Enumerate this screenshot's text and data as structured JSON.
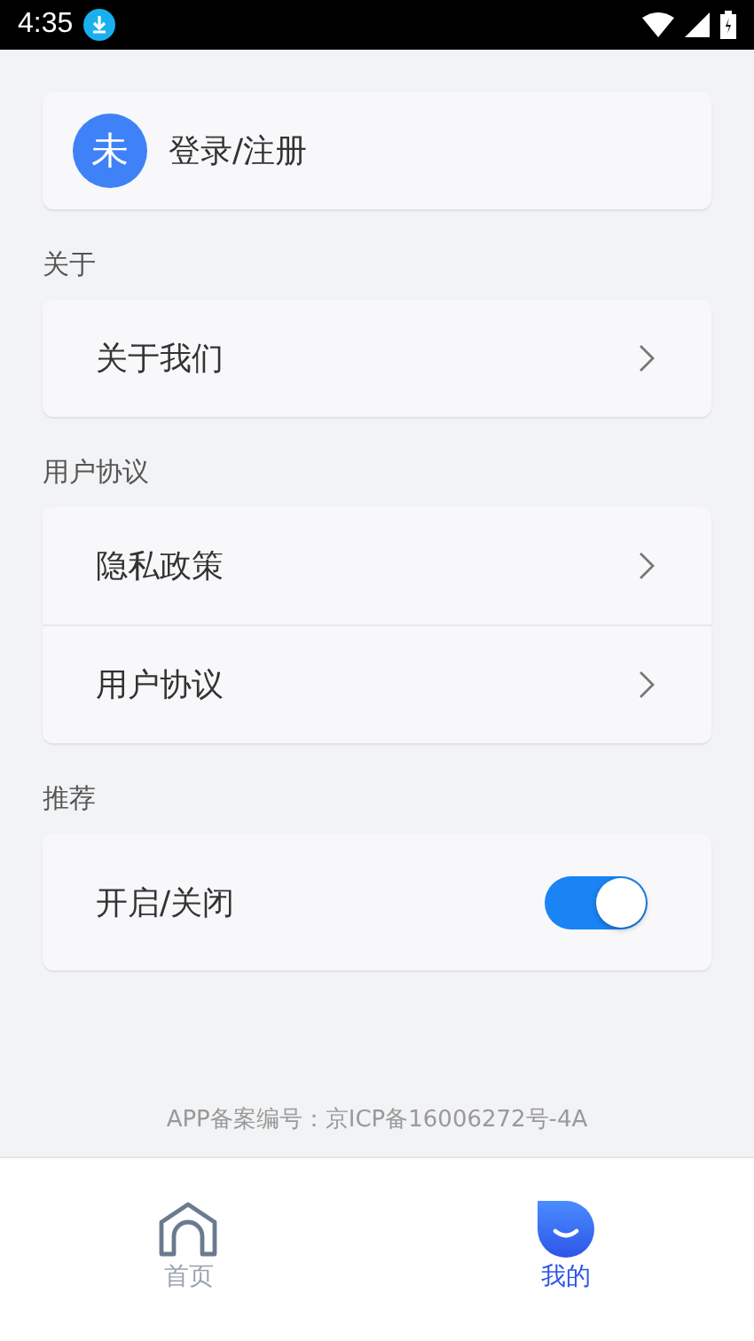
{
  "status_bar": {
    "time": "4:35"
  },
  "login": {
    "avatar_text": "未",
    "label": "登录/注册"
  },
  "sections": [
    {
      "title": "关于",
      "items": [
        {
          "kind": "link",
          "label": "关于我们"
        }
      ]
    },
    {
      "title": "用户协议",
      "items": [
        {
          "kind": "link",
          "label": "隐私政策"
        },
        {
          "kind": "link",
          "label": "用户协议"
        }
      ]
    },
    {
      "title": "推荐",
      "items": [
        {
          "kind": "toggle",
          "label": "开启/关闭",
          "on": true
        }
      ]
    }
  ],
  "footer": "APP备案编号：京ICP备16006272号-4A",
  "nav": [
    {
      "label": "首页",
      "kind": "home",
      "selected": false
    },
    {
      "label": "我的",
      "kind": "profile",
      "selected": true
    }
  ]
}
